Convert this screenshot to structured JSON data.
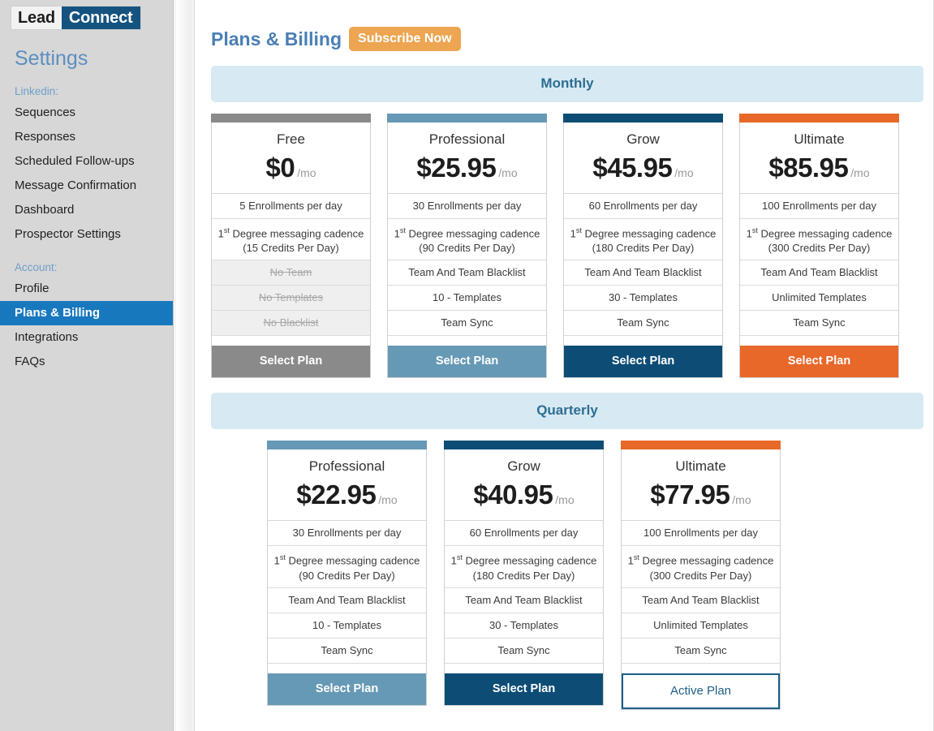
{
  "brand": {
    "logo_first": "Lead",
    "logo_second": "Connect",
    "navy": "#14537f"
  },
  "sidebar": {
    "title": "Settings",
    "groups": [
      {
        "label": "Linkedin:",
        "items": [
          {
            "label": "Sequences",
            "active": false
          },
          {
            "label": "Responses",
            "active": false
          },
          {
            "label": "Scheduled Follow-ups",
            "active": false
          },
          {
            "label": "Message Confirmation",
            "active": false
          },
          {
            "label": "Dashboard",
            "active": false
          },
          {
            "label": "Prospector Settings",
            "active": false
          }
        ]
      },
      {
        "label": "Account:",
        "items": [
          {
            "label": "Profile",
            "active": false
          },
          {
            "label": "Plans & Billing",
            "active": true
          },
          {
            "label": "Integrations",
            "active": false
          },
          {
            "label": "FAQs",
            "active": false
          }
        ]
      }
    ]
  },
  "header": {
    "title": "Plans & Billing",
    "subscribe_label": "Subscribe Now",
    "subscribe_color": "#eda552",
    "title_color": "#4a7fb5"
  },
  "sections": [
    {
      "banner": "Monthly",
      "cards": [
        {
          "name": "Free",
          "price": "$0",
          "period": "/mo",
          "accent": "#8a8a8a",
          "features": [
            {
              "text": "5 Enrollments per day",
              "disabled": false,
              "two_line": false
            },
            {
              "text": "1st Degree messaging cadence (15 Credits Per Day)",
              "line1": "1",
              "sup": "st",
              "line1b": " Degree messaging cadence",
              "line2": "(15 Credits Per Day)",
              "disabled": false,
              "two_line": true
            },
            {
              "text": "No Team",
              "disabled": true,
              "two_line": false
            },
            {
              "text": "No Templates",
              "disabled": true,
              "two_line": false
            },
            {
              "text": "No Blacklist",
              "disabled": true,
              "two_line": false
            }
          ],
          "cta": "Select Plan",
          "cta_state": "select"
        },
        {
          "name": "Professional",
          "price": "$25.95",
          "period": "/mo",
          "accent": "#6699b5",
          "features": [
            {
              "text": "30 Enrollments per day",
              "disabled": false,
              "two_line": false
            },
            {
              "text": "1st Degree messaging cadence (90 Credits Per Day)",
              "line1": "1",
              "sup": "st",
              "line1b": " Degree messaging cadence",
              "line2": "(90 Credits Per Day)",
              "disabled": false,
              "two_line": true
            },
            {
              "text": "Team And Team Blacklist",
              "disabled": false,
              "two_line": false
            },
            {
              "text": "10 - Templates",
              "disabled": false,
              "two_line": false
            },
            {
              "text": "Team Sync",
              "disabled": false,
              "two_line": false
            }
          ],
          "cta": "Select Plan",
          "cta_state": "select"
        },
        {
          "name": "Grow",
          "price": "$45.95",
          "period": "/mo",
          "accent": "#0d4d75",
          "features": [
            {
              "text": "60 Enrollments per day",
              "disabled": false,
              "two_line": false
            },
            {
              "text": "1st Degree messaging cadence (180 Credits Per Day)",
              "line1": "1",
              "sup": "st",
              "line1b": " Degree messaging cadence",
              "line2": "(180 Credits Per Day)",
              "disabled": false,
              "two_line": true
            },
            {
              "text": "Team And Team Blacklist",
              "disabled": false,
              "two_line": false
            },
            {
              "text": "30 - Templates",
              "disabled": false,
              "two_line": false
            },
            {
              "text": "Team Sync",
              "disabled": false,
              "two_line": false
            }
          ],
          "cta": "Select Plan",
          "cta_state": "select"
        },
        {
          "name": "Ultimate",
          "price": "$85.95",
          "period": "/mo",
          "accent": "#e8682a",
          "features": [
            {
              "text": "100 Enrollments per day",
              "disabled": false,
              "two_line": false
            },
            {
              "text": "1st Degree messaging cadence (300 Credits Per Day)",
              "line1": "1",
              "sup": "st",
              "line1b": " Degree messaging cadence",
              "line2": "(300 Credits Per Day)",
              "disabled": false,
              "two_line": true
            },
            {
              "text": "Team And Team Blacklist",
              "disabled": false,
              "two_line": false
            },
            {
              "text": "Unlimited Templates",
              "disabled": false,
              "two_line": false
            },
            {
              "text": "Team Sync",
              "disabled": false,
              "two_line": false
            }
          ],
          "cta": "Select Plan",
          "cta_state": "select"
        }
      ]
    },
    {
      "banner": "Quarterly",
      "cards": [
        {
          "name": "Professional",
          "price": "$22.95",
          "period": "/mo",
          "accent": "#6699b5",
          "features": [
            {
              "text": "30 Enrollments per day",
              "disabled": false,
              "two_line": false
            },
            {
              "text": "1st Degree messaging cadence (90 Credits Per Day)",
              "line1": "1",
              "sup": "st",
              "line1b": " Degree messaging cadence",
              "line2": "(90 Credits Per Day)",
              "disabled": false,
              "two_line": true
            },
            {
              "text": "Team And Team Blacklist",
              "disabled": false,
              "two_line": false
            },
            {
              "text": "10 - Templates",
              "disabled": false,
              "two_line": false
            },
            {
              "text": "Team Sync",
              "disabled": false,
              "two_line": false
            }
          ],
          "cta": "Select Plan",
          "cta_state": "select"
        },
        {
          "name": "Grow",
          "price": "$40.95",
          "period": "/mo",
          "accent": "#0d4d75",
          "features": [
            {
              "text": "60 Enrollments per day",
              "disabled": false,
              "two_line": false
            },
            {
              "text": "1st Degree messaging cadence (180 Credits Per Day)",
              "line1": "1",
              "sup": "st",
              "line1b": " Degree messaging cadence",
              "line2": "(180 Credits Per Day)",
              "disabled": false,
              "two_line": true
            },
            {
              "text": "Team And Team Blacklist",
              "disabled": false,
              "two_line": false
            },
            {
              "text": "30 - Templates",
              "disabled": false,
              "two_line": false
            },
            {
              "text": "Team Sync",
              "disabled": false,
              "two_line": false
            }
          ],
          "cta": "Select Plan",
          "cta_state": "select"
        },
        {
          "name": "Ultimate",
          "price": "$77.95",
          "period": "/mo",
          "accent": "#e8682a",
          "features": [
            {
              "text": "100 Enrollments per day",
              "disabled": false,
              "two_line": false
            },
            {
              "text": "1st Degree messaging cadence (300 Credits Per Day)",
              "line1": "1",
              "sup": "st",
              "line1b": " Degree messaging cadence",
              "line2": "(300 Credits Per Day)",
              "disabled": false,
              "two_line": true
            },
            {
              "text": "Team And Team Blacklist",
              "disabled": false,
              "two_line": false
            },
            {
              "text": "Unlimited Templates",
              "disabled": false,
              "two_line": false
            },
            {
              "text": "Team Sync",
              "disabled": false,
              "two_line": false
            }
          ],
          "cta": "Active Plan",
          "cta_state": "active"
        }
      ]
    }
  ]
}
